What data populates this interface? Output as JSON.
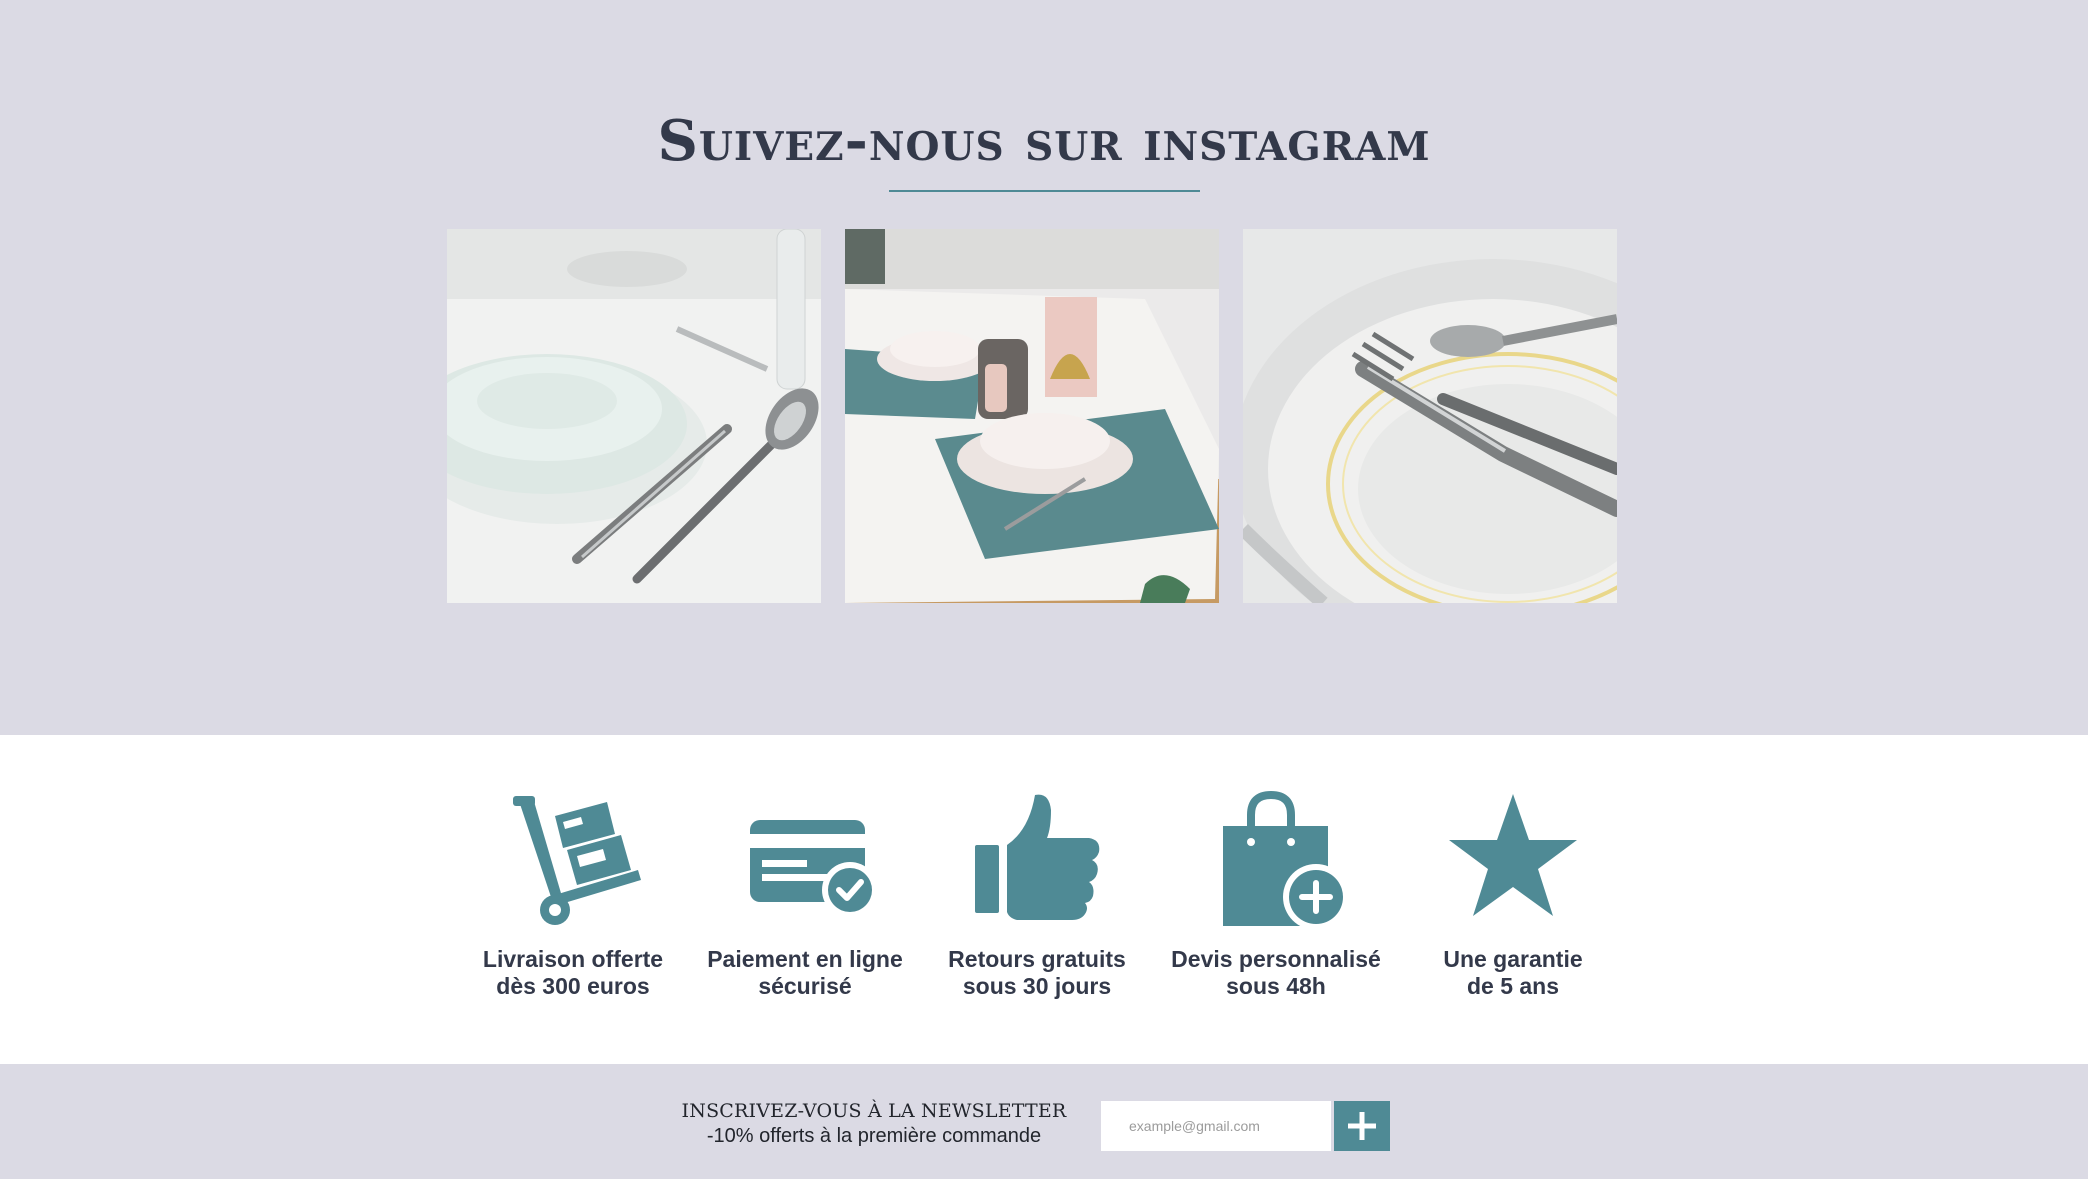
{
  "instagram": {
    "title": "Suivez-nous sur instagram",
    "photos": [
      {
        "icon": "table-setting-white-plates-photo"
      },
      {
        "icon": "table-setting-teal-placemat-photo"
      },
      {
        "icon": "cutlery-on-gold-rim-plate-photo"
      }
    ]
  },
  "features": [
    {
      "icon": "hand-truck-icon",
      "label": "Livraison offerte\ndès 300 euros"
    },
    {
      "icon": "credit-card-check-icon",
      "label": "Paiement en ligne\nsécurisé"
    },
    {
      "icon": "thumbs-up-icon",
      "label": "Retours gratuits\nsous 30 jours"
    },
    {
      "icon": "shopping-bag-plus-icon",
      "label": "Devis personnalisé\nsous 48h"
    },
    {
      "icon": "star-icon",
      "label": "Une garantie\nde 5 ans"
    }
  ],
  "newsletter": {
    "title": "INSCRIVEZ-VOUS À LA NEWSLETTER",
    "subtitle": "-10% offerts à la première commande",
    "email_placeholder": "example@gmail.com",
    "submit_icon": "plus-icon"
  },
  "colors": {
    "background": "#dbdae4",
    "accent": "#4f8a95",
    "text": "#33394a"
  }
}
